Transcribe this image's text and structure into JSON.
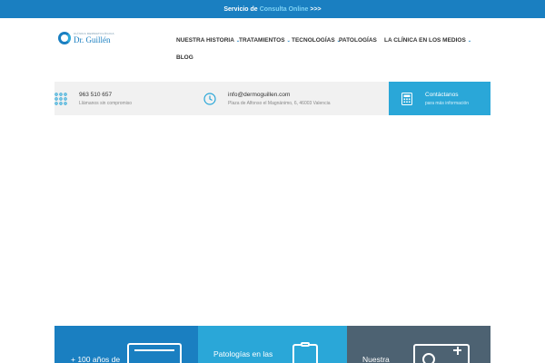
{
  "topbar": {
    "prefix": "Servicio de",
    "highlight": "Consulta Online",
    "suffix": ">>>"
  },
  "logo": {
    "small": "CLÍNICA DERMATOLÓGICA",
    "big": "Dr. Guillén"
  },
  "nav": {
    "items": [
      {
        "label": "NUESTRA HISTORIA",
        "dropdown": true
      },
      {
        "label": "TRATAMIENTOS",
        "dropdown": true
      },
      {
        "label": "TECNOLOGÍAS",
        "dropdown": true
      },
      {
        "label": "PATOLOGÍAS",
        "dropdown": false
      },
      {
        "label": "LA CLÍNICA EN LOS MEDIOS",
        "dropdown": true
      },
      {
        "label": "BLOG",
        "dropdown": false
      }
    ]
  },
  "info": {
    "phone": {
      "main": "963 510 657",
      "sub": "Llámanos sin compromiso",
      "icon": "dialpad-icon"
    },
    "email": {
      "main": "info@dermoguillen.com",
      "sub": "Plaza de Alfonso el Magnánimo, 6, 46003 Valencia",
      "icon": "clock-icon"
    },
    "contact": {
      "main": "Contáctanos",
      "sub": "para más información",
      "icon": "calculator-icon"
    }
  },
  "cards": [
    {
      "title": "+ 100 años de",
      "icon": "certificate-icon"
    },
    {
      "title": "Patologías en las",
      "icon": "clipboard-icon"
    },
    {
      "title": "Nuestra",
      "icon": "medical-kit-icon"
    }
  ],
  "colors": {
    "primary": "#1a7fc1",
    "accent": "#2aa7d8",
    "dark": "#4d6272",
    "info_bg": "#f1f1f1"
  }
}
